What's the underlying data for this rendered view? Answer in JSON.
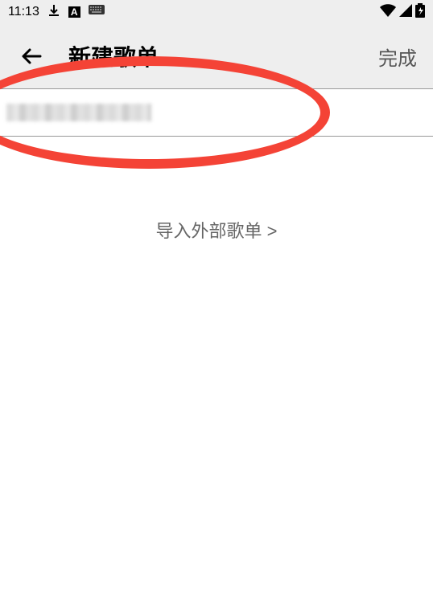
{
  "status_bar": {
    "time": "11:13",
    "download_icon": "↓",
    "a_icon": "A",
    "keyboard_icon": "⌨",
    "wifi_icon": "▾",
    "signal_icon": "◢",
    "battery_icon": "🔋"
  },
  "header": {
    "title": "新建歌单",
    "done_label": "完成"
  },
  "input": {
    "value": ""
  },
  "import_link": {
    "label": "导入外部歌单 >"
  }
}
